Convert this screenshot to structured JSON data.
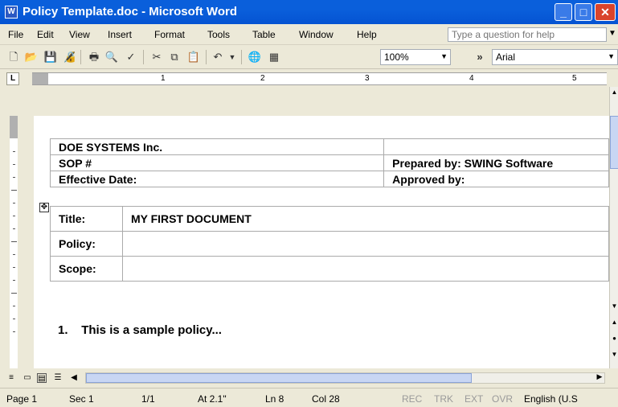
{
  "window": {
    "title": "Policy Template.doc - Microsoft Word",
    "app_icon": "W"
  },
  "menu": [
    "File",
    "Edit",
    "View",
    "Insert",
    "Format",
    "Tools",
    "Table",
    "Window",
    "Help"
  ],
  "help_box": {
    "placeholder": "Type a question for help"
  },
  "toolbar": {
    "zoom": "100%",
    "font": "Arial",
    "more": "»"
  },
  "ruler": {
    "numbers": [
      "1",
      "2",
      "3",
      "4",
      "5"
    ]
  },
  "header_table": {
    "company": "DOE SYSTEMS Inc.",
    "sop": "SOP #",
    "prepared_by": "Prepared by: SWING Software",
    "effective_date": "Effective Date:",
    "approved_by": "Approved by:"
  },
  "info_table": {
    "title_label": "Title:",
    "title_value": "MY FIRST DOCUMENT",
    "policy_label": "Policy:",
    "policy_value": "",
    "scope_label": "Scope:",
    "scope_value": ""
  },
  "body": {
    "item_number": "1.",
    "item_text": "This is a sample policy..."
  },
  "status": {
    "page": "Page 1",
    "sec": "Sec 1",
    "pages": "1/1",
    "at": "At 2.1\"",
    "ln": "Ln 8",
    "col": "Col 28",
    "rec": "REC",
    "trk": "TRK",
    "ext": "EXT",
    "ovr": "OVR",
    "lang": "English (U.S"
  }
}
